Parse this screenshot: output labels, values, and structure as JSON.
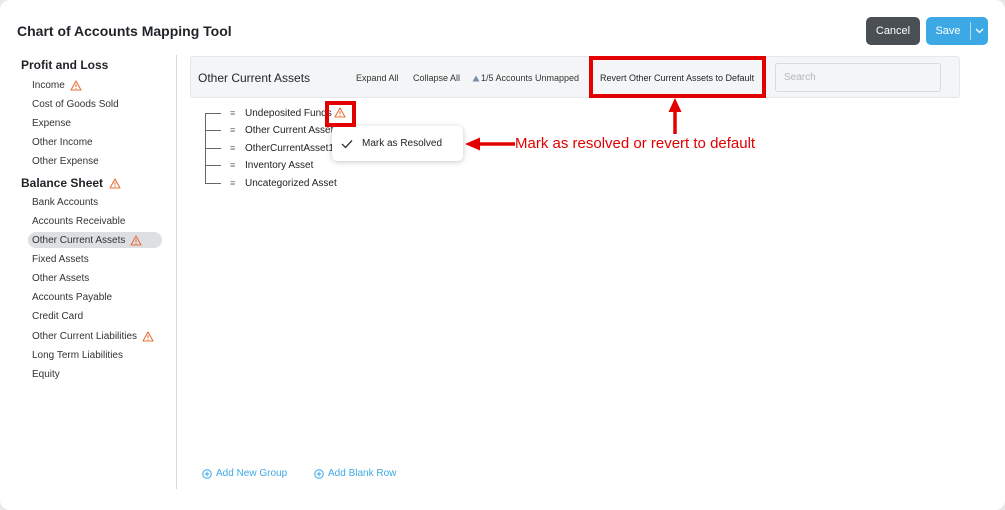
{
  "header": {
    "title": "Chart of Accounts Mapping Tool",
    "cancel_label": "Cancel",
    "save_label": "Save"
  },
  "sidebar": {
    "profit_loss": {
      "heading": "Profit and Loss",
      "items": [
        "Income",
        "Cost of Goods Sold",
        "Expense",
        "Other Income",
        "Other Expense"
      ]
    },
    "balance_sheet": {
      "heading": "Balance Sheet",
      "items": [
        "Bank Accounts",
        "Accounts Receivable",
        "Other Current Assets",
        "Fixed Assets",
        "Other Assets",
        "Accounts Payable",
        "Credit Card",
        "Other Current Liabilities",
        "Long Term Liabilities",
        "Equity"
      ],
      "active_item": "Other Current Assets"
    }
  },
  "toolbar": {
    "title": "Other Current Assets",
    "expand_all": "Expand All",
    "collapse_all": "Collapse All",
    "unmapped": "1/5 Accounts Unmapped",
    "revert": "Revert Other Current Assets to Default",
    "search_placeholder": "Search"
  },
  "tree": {
    "rows": [
      "Undeposited Funds",
      "Other Current Asset",
      "OtherCurrentAsset1",
      "Inventory Asset",
      "Uncategorized Asset"
    ]
  },
  "popup": {
    "label": "Mark as Resolved"
  },
  "annotation": {
    "text": "Mark as resolved or revert to default"
  },
  "footer": {
    "add_group": "Add New Group",
    "add_row": "Add Blank Row"
  },
  "colors": {
    "accent": "#3ca9e4",
    "warning": "#e8703a",
    "annotation_red": "#e30000",
    "cancel_bg": "#4a4f55"
  }
}
